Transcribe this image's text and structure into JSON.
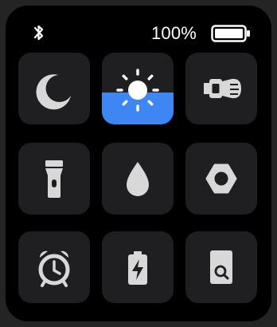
{
  "status_bar": {
    "bluetooth_icon": "bluetooth-icon",
    "battery_percent": "100%",
    "battery_level": 1.0,
    "battery_icon": "battery-full-icon"
  },
  "tiles": [
    {
      "name": "do-not-disturb",
      "icon": "moon-icon"
    },
    {
      "name": "brightness",
      "icon": "sun-icon",
      "active_fill_fraction": 0.45,
      "accent": "#3f86f5"
    },
    {
      "name": "find-phone",
      "icon": "watch-phone-icon"
    },
    {
      "name": "flashlight",
      "icon": "flashlight-icon"
    },
    {
      "name": "water-lock",
      "icon": "water-drop-icon"
    },
    {
      "name": "settings",
      "icon": "hexagon-nut-icon"
    },
    {
      "name": "alarm",
      "icon": "alarm-clock-icon"
    },
    {
      "name": "power-saving",
      "icon": "battery-charging-icon"
    },
    {
      "name": "find-device",
      "icon": "search-phone-icon"
    }
  ],
  "colors": {
    "background": "#000000",
    "tile": "#1f1f21",
    "icon": "#d8d8d8",
    "accent": "#3f86f5"
  }
}
